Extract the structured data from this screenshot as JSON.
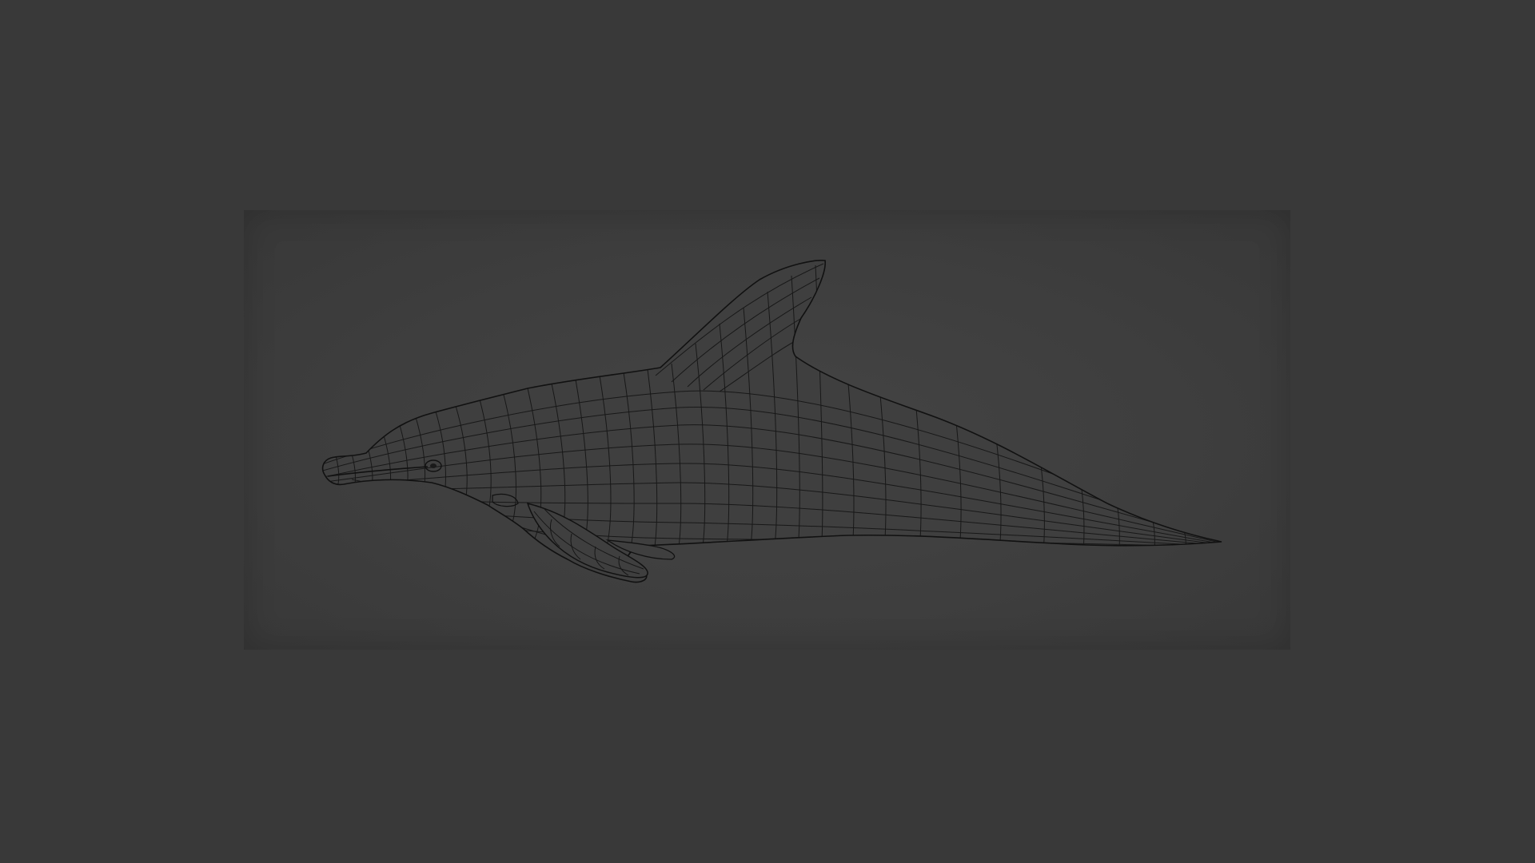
{
  "viewport": {
    "background_color": "#393939",
    "frame_color": "#424242",
    "wire_color": "#141414"
  },
  "model": {
    "icon": "dolphin-wireframe-icon"
  }
}
